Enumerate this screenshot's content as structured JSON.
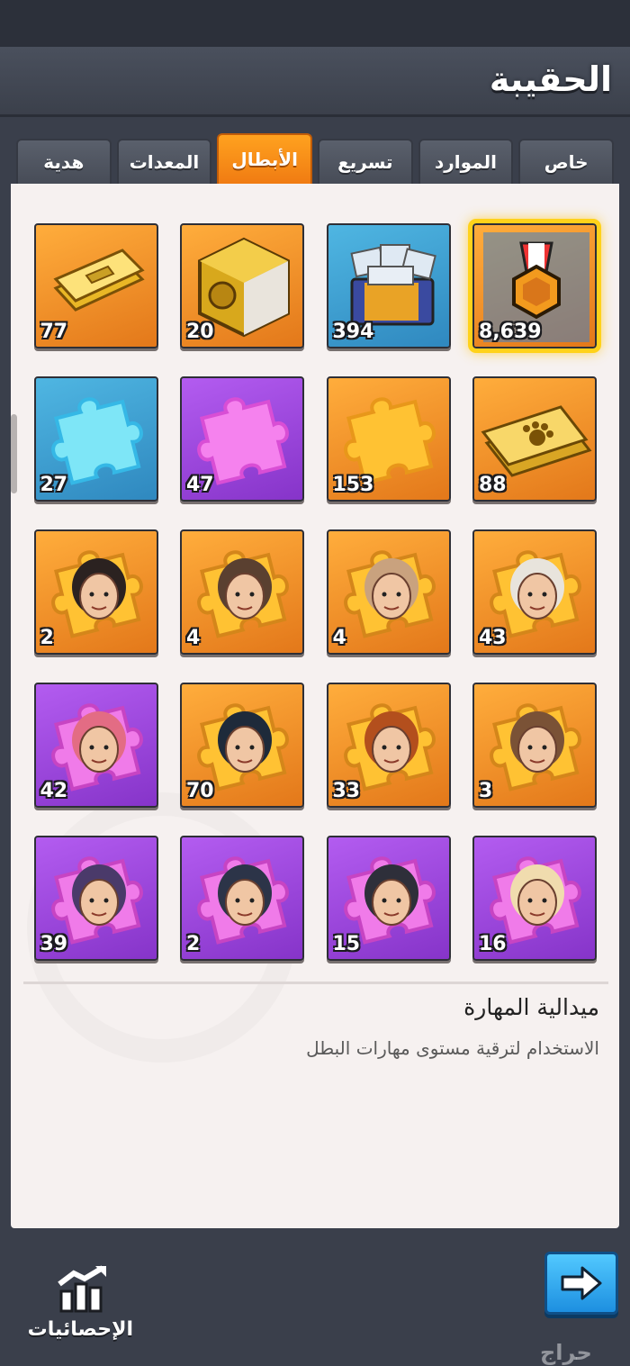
{
  "header": {
    "title": "الحقيبة"
  },
  "tabs": [
    {
      "label": "خاص",
      "active": false
    },
    {
      "label": "الموارد",
      "active": false
    },
    {
      "label": "تسريع",
      "active": false
    },
    {
      "label": "الأبطال",
      "active": true
    },
    {
      "label": "المعدات",
      "active": false
    },
    {
      "label": "هدية",
      "active": false
    }
  ],
  "items": [
    {
      "icon": "skill-medal-icon",
      "count": "8,639",
      "bg": "orange",
      "selected": true
    },
    {
      "icon": "exp-book-chest-icon",
      "count": "394",
      "bg": "blue"
    },
    {
      "icon": "gold-cube-chest-icon",
      "count": "20",
      "bg": "orange"
    },
    {
      "icon": "gold-ticket-icon",
      "count": "77",
      "bg": "orange"
    },
    {
      "icon": "paw-ticket-icon",
      "count": "88",
      "bg": "orange"
    },
    {
      "icon": "orange-puzzle-piece-icon",
      "count": "153",
      "bg": "orange"
    },
    {
      "icon": "purple-puzzle-piece-icon",
      "count": "47",
      "bg": "purple"
    },
    {
      "icon": "blue-puzzle-piece-icon",
      "count": "27",
      "bg": "blue"
    },
    {
      "icon": "hero-shard-old-man-icon",
      "count": "43",
      "bg": "orange"
    },
    {
      "icon": "hero-shard-woman-icon",
      "count": "4",
      "bg": "orange"
    },
    {
      "icon": "hero-shard-bearded-man-icon",
      "count": "4",
      "bg": "orange"
    },
    {
      "icon": "hero-shard-man-icon",
      "count": "2",
      "bg": "orange"
    },
    {
      "icon": "hero-shard-curly-woman-icon",
      "count": "3",
      "bg": "orange"
    },
    {
      "icon": "hero-shard-redhead-woman-icon",
      "count": "33",
      "bg": "orange"
    },
    {
      "icon": "hero-shard-goggles-man-icon",
      "count": "70",
      "bg": "orange"
    },
    {
      "icon": "hero-shard-pink-hair-woman-icon",
      "count": "42",
      "bg": "purple"
    },
    {
      "icon": "hero-shard-blonde-woman-icon",
      "count": "16",
      "bg": "purple"
    },
    {
      "icon": "hero-shard-hooded-man-icon",
      "count": "15",
      "bg": "purple"
    },
    {
      "icon": "hero-shard-officer-icon",
      "count": "2",
      "bg": "purple"
    },
    {
      "icon": "hero-shard-hooded-woman-icon",
      "count": "39",
      "bg": "purple"
    }
  ],
  "description": {
    "title": "ميدالية المهارة",
    "text": "الاستخدام لترقية مستوى مهارات البطل"
  },
  "footer": {
    "stats_label": "الإحصائيات",
    "stats_icon": "bar-chart-icon",
    "next_icon": "arrow-right-icon"
  },
  "watermark": "حراج"
}
